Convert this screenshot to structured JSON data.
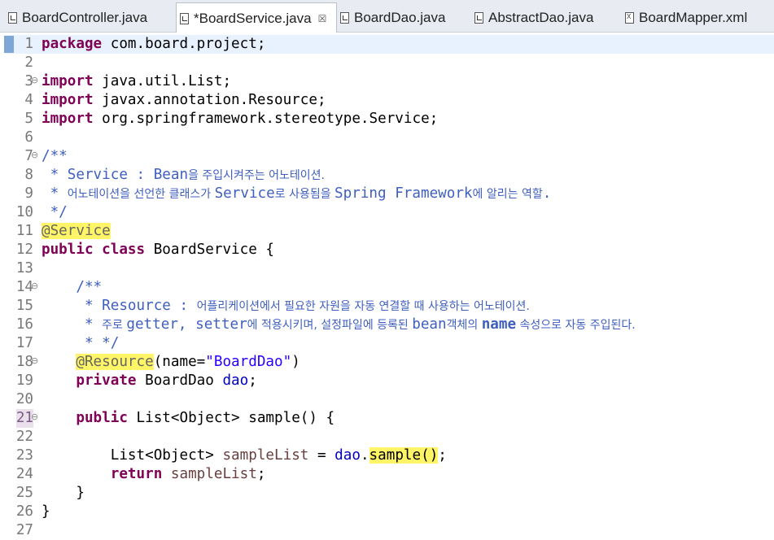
{
  "tabs": [
    {
      "label": "BoardController.java",
      "icon": "java-file-icon",
      "active": false
    },
    {
      "label": "*BoardService.java",
      "icon": "java-file-icon",
      "active": true,
      "close": "☒"
    },
    {
      "label": "BoardDao.java",
      "icon": "java-file-icon",
      "active": false
    },
    {
      "label": "AbstractDao.java",
      "icon": "java-file-icon",
      "active": false
    },
    {
      "label": "BoardMapper.xml",
      "icon": "xml-file-icon",
      "active": false
    }
  ],
  "editor": {
    "lines": [
      {
        "n": "1",
        "t": [
          [
            "package",
            "kw"
          ],
          [
            " com.board.project;",
            ""
          ]
        ]
      },
      {
        "n": "2",
        "t": []
      },
      {
        "n": "3",
        "t": [
          [
            "import",
            "kw"
          ],
          [
            " java.util.List;",
            ""
          ]
        ]
      },
      {
        "n": "4",
        "t": [
          [
            "import",
            "kw"
          ],
          [
            " javax.annotation.Resource;",
            ""
          ]
        ]
      },
      {
        "n": "5",
        "t": [
          [
            "import",
            "kw"
          ],
          [
            " org.springframework.stereotype.Service;",
            ""
          ]
        ]
      },
      {
        "n": "6",
        "t": []
      },
      {
        "n": "7",
        "t": [
          [
            "/**",
            "cm"
          ]
        ]
      },
      {
        "n": "8",
        "t": [
          [
            " * Service : Bean",
            "cm"
          ],
          [
            "을 주입시켜주는 어노테이션.",
            "cmt"
          ]
        ]
      },
      {
        "n": "9",
        "t": [
          [
            " * ",
            "cm"
          ],
          [
            "어노테이션을 선언한 클래스가 ",
            "cmt"
          ],
          [
            "Service",
            "cm"
          ],
          [
            "로 사용됨을 ",
            "cmt"
          ],
          [
            "Spring Framework",
            "cm"
          ],
          [
            "에 알리는 역할",
            "cmt"
          ],
          [
            ".",
            "cm"
          ]
        ]
      },
      {
        "n": "10",
        "t": [
          [
            " */",
            "cm"
          ]
        ]
      },
      {
        "n": "11",
        "t": [
          [
            "@Service",
            "an hl"
          ]
        ]
      },
      {
        "n": "12",
        "t": [
          [
            "public class",
            "kw"
          ],
          [
            " BoardService {",
            ""
          ]
        ]
      },
      {
        "n": "13",
        "t": []
      },
      {
        "n": "14",
        "t": [
          [
            "    /**",
            "cm"
          ]
        ]
      },
      {
        "n": "15",
        "t": [
          [
            "     * Resource : ",
            "cm"
          ],
          [
            "어플리케이션에서 필요한 자원을 자동 연결할 때 사용하는 어노테이션.",
            "cmt"
          ]
        ]
      },
      {
        "n": "16",
        "t": [
          [
            "     * ",
            "cm"
          ],
          [
            "주로 ",
            "cmt"
          ],
          [
            "getter, setter",
            "cm"
          ],
          [
            "에 적용시키며, 설정파일에 등록된 ",
            "cmt"
          ],
          [
            "bean",
            "cm"
          ],
          [
            "객체의 ",
            "cmt"
          ],
          [
            "name",
            "cmk"
          ],
          [
            " 속성으로 자동 주입된다.",
            "cmt"
          ]
        ]
      },
      {
        "n": "17",
        "t": [
          [
            "     * */",
            "cm"
          ]
        ]
      },
      {
        "n": "18",
        "t": [
          [
            "    ",
            ""
          ],
          [
            "@Resource",
            "an hl"
          ],
          [
            "(name=",
            ""
          ],
          [
            "\"BoardDao\"",
            "str"
          ],
          [
            ")",
            ""
          ]
        ]
      },
      {
        "n": "19",
        "t": [
          [
            "    ",
            ""
          ],
          [
            "private",
            "kw"
          ],
          [
            " BoardDao ",
            ""
          ],
          [
            "dao",
            "fld"
          ],
          [
            ";",
            ""
          ]
        ]
      },
      {
        "n": "20",
        "t": []
      },
      {
        "n": "21",
        "t": [
          [
            "    ",
            ""
          ],
          [
            "public",
            "kw"
          ],
          [
            " List<Object> sample() {",
            ""
          ]
        ]
      },
      {
        "n": "22",
        "t": []
      },
      {
        "n": "23",
        "t": [
          [
            "        List<Object> ",
            ""
          ],
          [
            "sampleList",
            "var"
          ],
          [
            " = ",
            ""
          ],
          [
            "dao",
            "fld"
          ],
          [
            ".",
            ""
          ],
          [
            "sample()",
            "hl"
          ],
          [
            ";",
            ""
          ]
        ]
      },
      {
        "n": "24",
        "t": [
          [
            "        ",
            ""
          ],
          [
            "return",
            "kw"
          ],
          [
            " ",
            ""
          ],
          [
            "sampleList",
            "var"
          ],
          [
            ";",
            ""
          ]
        ]
      },
      {
        "n": "25",
        "t": [
          [
            "    }",
            ""
          ]
        ]
      },
      {
        "n": "26",
        "t": [
          [
            "}",
            ""
          ]
        ]
      },
      {
        "n": "27",
        "t": []
      }
    ],
    "fold_lines": [
      "3",
      "7",
      "14",
      "18",
      "21"
    ],
    "fold_glyph": "⊖",
    "current_line": "1",
    "marked_line": "21"
  }
}
